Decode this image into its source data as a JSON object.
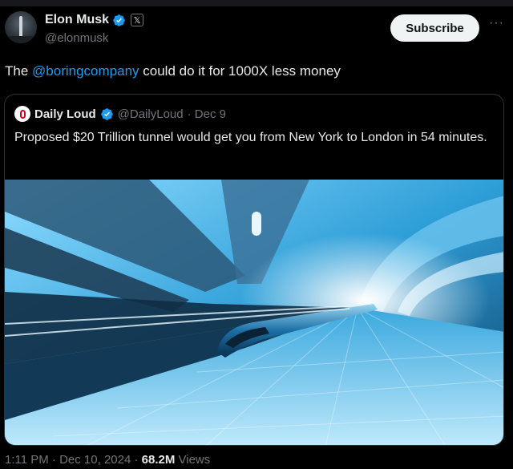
{
  "author": {
    "name": "Elon Musk",
    "handle": "@elonmusk",
    "verified_icon": "verified-badge-icon",
    "affiliation_icon": "x-logo-icon",
    "affiliation_text": "𝕏"
  },
  "actions": {
    "subscribe_label": "Subscribe",
    "more_label": "···"
  },
  "tweet": {
    "text_prefix": "The ",
    "mention": "@boringcompany",
    "text_suffix": " could do it for 1000X less money"
  },
  "quoted": {
    "name": "Daily Loud",
    "handle": "@DailyLoud",
    "date": "· Dec 9",
    "text": "Proposed $20 Trillion tunnel would get you from New York to London in 54 minutes."
  },
  "footer": {
    "time": "1:11 PM · Dec 10, 2024 · ",
    "views_count": "68.2M",
    "views_label": " Views"
  },
  "colors": {
    "accent": "#1d9bf0",
    "background": "#000000",
    "muted": "#71767b"
  }
}
